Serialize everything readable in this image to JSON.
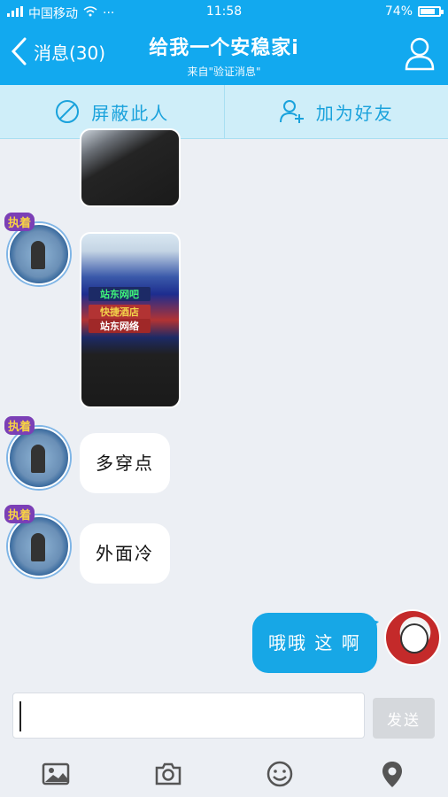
{
  "status_bar": {
    "carrier": "中国移动",
    "dots": "···",
    "time": "11:58",
    "battery_percent": "74%",
    "battery_level": 0.74
  },
  "header": {
    "back_label": "消息(30)",
    "title": "给我一个安稳家i",
    "subtitle": "来自\"验证消息\""
  },
  "actions": {
    "block_label": "屏蔽此人",
    "add_friend_label": "加为好友"
  },
  "avatar_sticker_text": "执着",
  "image_signs": [
    "站东网吧",
    "快捷酒店",
    "站东网络"
  ],
  "messages": [
    {
      "from": "them",
      "type": "image"
    },
    {
      "from": "them",
      "type": "image"
    },
    {
      "from": "them",
      "type": "text",
      "text": "多穿点"
    },
    {
      "from": "them",
      "type": "text",
      "text": "外面冷"
    },
    {
      "from": "me",
      "type": "text",
      "text": "哦哦 这 啊"
    }
  ],
  "input": {
    "value": "",
    "send_label": "发送"
  },
  "toolbar_icons": [
    "image-icon",
    "camera-icon",
    "emoji-icon",
    "location-icon"
  ],
  "colors": {
    "primary": "#12a9ef",
    "action_bar_bg": "#cfeef9",
    "my_bubble": "#17a7e6",
    "chat_bg": "#eceff4"
  }
}
